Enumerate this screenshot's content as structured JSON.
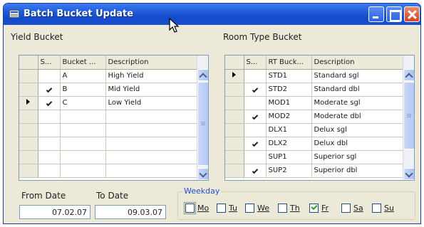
{
  "window": {
    "title": "Batch Bucket Update",
    "icons": {
      "app": "window-icon",
      "minimize": "minimize-icon",
      "maximize": "maximize-icon",
      "close": "close-icon"
    }
  },
  "yield_bucket": {
    "title": "Yield Bucket",
    "columns": [
      "S...",
      "Bucket ...",
      "Description"
    ],
    "rows": [
      {
        "selected": false,
        "current": false,
        "bucket": "A",
        "description": "High Yield"
      },
      {
        "selected": true,
        "current": false,
        "bucket": "B",
        "description": "Mid Yield"
      },
      {
        "selected": true,
        "current": true,
        "bucket": "C",
        "description": "Low Yield"
      },
      {
        "selected": false,
        "current": false,
        "bucket": "",
        "description": ""
      },
      {
        "selected": false,
        "current": false,
        "bucket": "",
        "description": ""
      },
      {
        "selected": false,
        "current": false,
        "bucket": "",
        "description": ""
      },
      {
        "selected": false,
        "current": false,
        "bucket": "",
        "description": ""
      },
      {
        "selected": false,
        "current": false,
        "bucket": "",
        "description": ""
      }
    ]
  },
  "room_type_bucket": {
    "title": "Room Type Bucket",
    "columns": [
      "S...",
      "RT Buck...",
      "Description"
    ],
    "rows": [
      {
        "selected": false,
        "current": true,
        "code": "STD1",
        "description": "Standard sgl"
      },
      {
        "selected": true,
        "current": false,
        "code": "STD2",
        "description": "Standard dbl"
      },
      {
        "selected": false,
        "current": false,
        "code": "MOD1",
        "description": "Moderate sgl"
      },
      {
        "selected": true,
        "current": false,
        "code": "MOD2",
        "description": "Moderate dbl"
      },
      {
        "selected": false,
        "current": false,
        "code": "DLX1",
        "description": "Delux sgl"
      },
      {
        "selected": true,
        "current": false,
        "code": "DLX2",
        "description": "Delux dbl"
      },
      {
        "selected": false,
        "current": false,
        "code": "SUP1",
        "description": "Superior sgl"
      },
      {
        "selected": true,
        "current": false,
        "code": "SUP2",
        "description": "Superior dbl"
      }
    ]
  },
  "from_date": {
    "label": "From Date",
    "value": "07.02.07"
  },
  "to_date": {
    "label": "To Date",
    "value": "09.03.07"
  },
  "weekday": {
    "legend": "Weekday",
    "days": [
      {
        "label": "Mo",
        "checked": false
      },
      {
        "label": "Tu",
        "checked": false
      },
      {
        "label": "We",
        "checked": false
      },
      {
        "label": "Th",
        "checked": false
      },
      {
        "label": "Fr",
        "checked": true
      },
      {
        "label": "Sa",
        "checked": false
      },
      {
        "label": "Su",
        "checked": false
      }
    ]
  }
}
